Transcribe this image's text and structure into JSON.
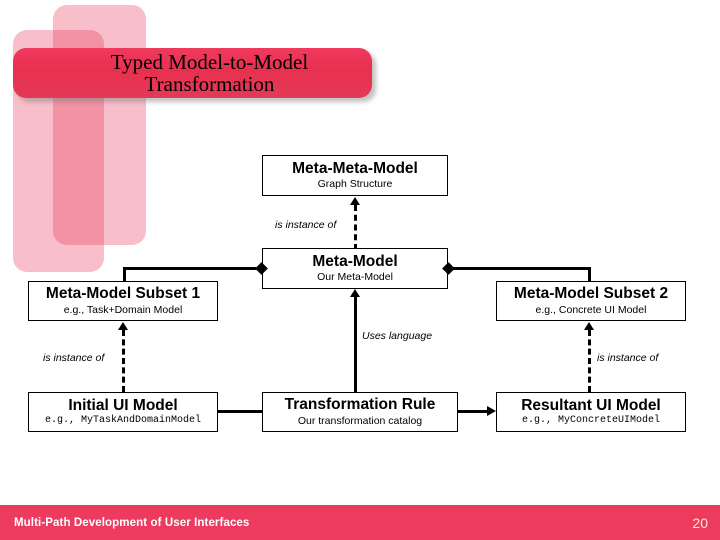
{
  "slide": {
    "title_line1": "Typed Model-to-Model",
    "title_line2": "Transformation",
    "accent_color": "#ec3b5e",
    "decoration_color": "#f4a7b9",
    "background_color": "#ffffff"
  },
  "diagram": {
    "type": "layered-model-transformation",
    "nodes": [
      {
        "id": "meta-meta-model",
        "title": "Meta-Meta-Model",
        "subtitle": "Graph Structure"
      },
      {
        "id": "meta-model",
        "title": "Meta-Model",
        "subtitle": "Our Meta-Model"
      },
      {
        "id": "meta-model-subset-1",
        "title": "Meta-Model Subset 1",
        "subtitle": "e.g., Task+Domain Model"
      },
      {
        "id": "meta-model-subset-2",
        "title": "Meta-Model Subset 2",
        "subtitle": "e.g., Concrete UI Model"
      },
      {
        "id": "initial-ui-model",
        "title": "Initial UI Model",
        "subtitle": "e.g., MyTaskAndDomainModel"
      },
      {
        "id": "transformation-rule",
        "title": "Transformation Rule",
        "subtitle": "Our transformation catalog"
      },
      {
        "id": "resultant-ui-model",
        "title": "Resultant UI Model",
        "subtitle": "e.g., MyConcreteUIModel"
      }
    ],
    "edge_labels": {
      "instance_of_top": "is instance of",
      "instance_of_left": "is instance of",
      "instance_of_right": "is instance of",
      "uses_language": "Uses language"
    }
  },
  "footer": {
    "text": "Multi-Path Development of User Interfaces",
    "page_number": "20"
  }
}
